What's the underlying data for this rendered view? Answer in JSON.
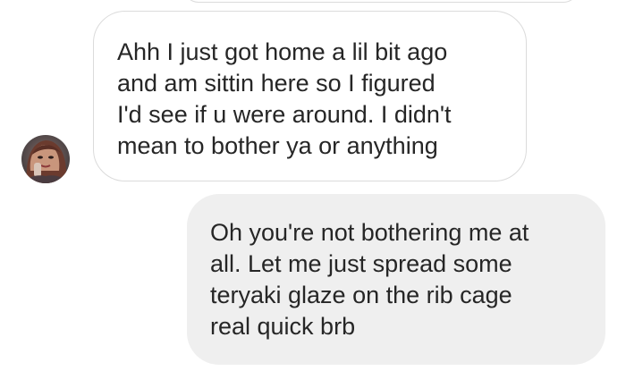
{
  "conversation": {
    "messages": [
      {
        "sender": "other",
        "text": "Ahh I just got home a lil bit ago\nand am sittin here so I figured\nI'd see if u were around. I didn't\nmean to bother ya or anything"
      },
      {
        "sender": "me",
        "text": "Oh you're not bothering me at\nall. Let me just spread some\nteryaki glaze on the rib cage\nreal quick brb"
      }
    ]
  },
  "colors": {
    "incoming_bubble_border": "#dbdbdb",
    "outgoing_bubble_bg": "#efefef",
    "text": "#262626"
  },
  "icons": {
    "avatar": "contact-profile-photo"
  }
}
